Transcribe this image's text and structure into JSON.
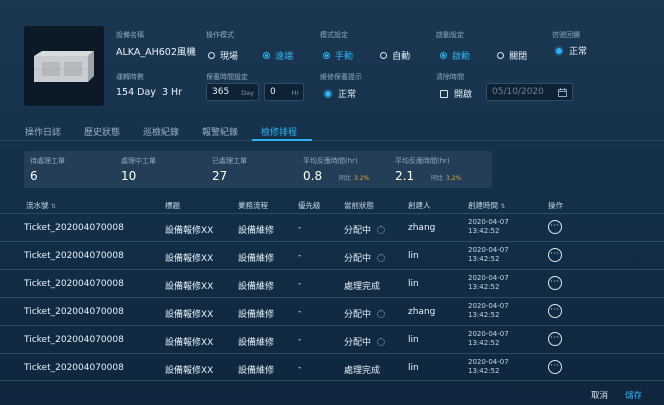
{
  "device": {
    "name_label": "設備名稱",
    "name_value": "ALKA_AH602風機",
    "run_days_label": "運轉時數",
    "run_days_value": "154 Day  3 Hr"
  },
  "operation_mode": {
    "label": "操作模式",
    "options": [
      "現場",
      "遠端"
    ],
    "selected": "遠端"
  },
  "schedule_mode": {
    "label": "模式設定",
    "options": [
      "手動",
      "自動"
    ],
    "selected": "手動"
  },
  "start_setting": {
    "label": "啟動設定",
    "options": [
      "啟動",
      "關閉"
    ],
    "selected": "啟動"
  },
  "signal_status": {
    "label": "信號回饋",
    "value": "正常"
  },
  "maintenance_period": {
    "label": "保養時間設定",
    "day_value": "365",
    "day_unit": "Day",
    "hr_value": "0",
    "hr_unit": "Hr"
  },
  "maintenance_alert": {
    "label": "維修保養提示",
    "value": "正常"
  },
  "clean_time": {
    "label": "清除時間",
    "checkbox_label": "開啟",
    "checked": false,
    "date_placeholder": "05/10/2020"
  },
  "tabs": [
    "操作日誌",
    "歷史狀態",
    "巡檢紀錄",
    "報警紀錄",
    "檢修排程"
  ],
  "active_tab": "檢修排程",
  "stats": [
    {
      "title": "待處理工單",
      "value": "6"
    },
    {
      "title": "處理中工單",
      "value": "10"
    },
    {
      "title": "已處理工單",
      "value": "27"
    },
    {
      "title": "平均反應時間(hr)",
      "value": "0.8",
      "compare_label": "同比",
      "compare_value": "3.2%"
    },
    {
      "title": "平均反應時間(hr)",
      "value": "2.1",
      "compare_label": "同比",
      "compare_value": "3.2%"
    }
  ],
  "table": {
    "headers": [
      "流水號",
      "標題",
      "業務流程",
      "優先級",
      "當前狀態",
      "創建人",
      "創建時間",
      "操作"
    ],
    "rows": [
      {
        "id": "Ticket_202004070008",
        "title": "設備報修XX",
        "process": "設備維修",
        "priority": "-",
        "status": "分配中",
        "loading": true,
        "creator": "zhang",
        "date": "2020-04-07",
        "time": "13:42:52"
      },
      {
        "id": "Ticket_202004070008",
        "title": "設備報修XX",
        "process": "設備維修",
        "priority": "-",
        "status": "分配中",
        "loading": true,
        "creator": "lin",
        "date": "2020-04-07",
        "time": "13:42:52"
      },
      {
        "id": "Ticket_202004070008",
        "title": "設備報修XX",
        "process": "設備維修",
        "priority": "-",
        "status": "處理完成",
        "loading": false,
        "creator": "lin",
        "date": "2020-04-07",
        "time": "13:42:52"
      },
      {
        "id": "Ticket_202004070008",
        "title": "設備報修XX",
        "process": "設備維修",
        "priority": "-",
        "status": "分配中",
        "loading": true,
        "creator": "zhang",
        "date": "2020-04-07",
        "time": "13:42:52"
      },
      {
        "id": "Ticket_202004070008",
        "title": "設備報修XX",
        "process": "設備維修",
        "priority": "-",
        "status": "分配中",
        "loading": true,
        "creator": "lin",
        "date": "2020-04-07",
        "time": "13:42:52"
      },
      {
        "id": "Ticket_202004070008",
        "title": "設備報修XX",
        "process": "設備維修",
        "priority": "-",
        "status": "處理完成",
        "loading": false,
        "creator": "lin",
        "date": "2020-04-07",
        "time": "13:42:52"
      }
    ]
  },
  "footer": {
    "cancel": "取消",
    "save": "儲存"
  },
  "colors": {
    "accent": "#2fb3f0",
    "warning": "#e2a83a",
    "background": "#143049"
  }
}
